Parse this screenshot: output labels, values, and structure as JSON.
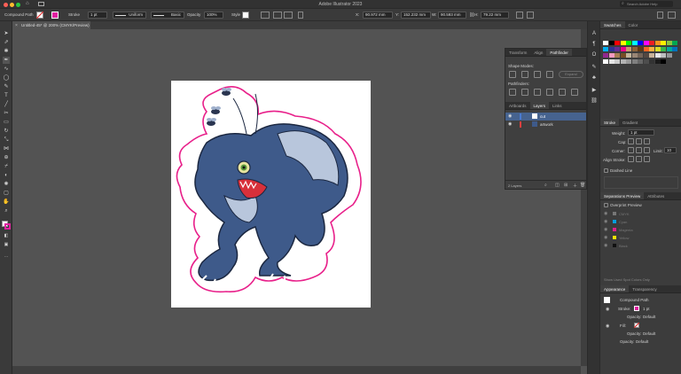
{
  "app_title": "Adobe Illustrator 2023",
  "search_placeholder": "Search Adobe Help",
  "control_bar": {
    "selection_label": "Compound Path",
    "stroke_label": "Stroke",
    "stroke_weight": "1 pt",
    "profile_uniform": "Uniform",
    "brush_basic": "Basic",
    "opacity_label": "Opacity",
    "opacity_value": "100%",
    "style_label": "Style",
    "x_value": "90.972 mm",
    "y_value": "152.232 mm",
    "w_value": "90.593 mm",
    "h_value": "79.22 mm"
  },
  "document_tab": {
    "title": "Untitled-45* @ 200% (CMYK/Preview)"
  },
  "pathfinder_panel": {
    "tabs": [
      "Transform",
      "Align",
      "Pathfinder"
    ],
    "active_tab": "Pathfinder",
    "shape_modes_label": "Shape Modes:",
    "expand_button": "Expand",
    "pathfinders_label": "Pathfinders:"
  },
  "layers_panel": {
    "tabs": [
      "Artboards",
      "Layers",
      "Links"
    ],
    "active_tab": "Layers",
    "layers": [
      {
        "name": "cut",
        "color": "#4a7bd0",
        "selected": true
      },
      {
        "name": "artwork",
        "color": "#e04040",
        "selected": false
      }
    ],
    "count": "2 Layers"
  },
  "swatches_panel": {
    "tabs": [
      "Swatches",
      "Color"
    ],
    "active_tab": "Swatches"
  },
  "stroke_panel": {
    "tabs": [
      "Stroke",
      "Gradient"
    ],
    "active_tab": "Stroke",
    "weight_label": "Weight:",
    "weight_value": "1 pt",
    "cap_label": "Cap:",
    "corner_label": "Corner:",
    "limit_label": "Limit:",
    "limit_value": "10",
    "align_label": "Align Stroke:",
    "dashed_label": "Dashed Line"
  },
  "separations_panel": {
    "tabs": [
      "Separations Preview",
      "Attributes"
    ],
    "active_tab": "Separations Preview",
    "overprint_label": "Overprint Preview",
    "inks": [
      {
        "name": "CMYK",
        "color": "#777777"
      },
      {
        "name": "Cyan",
        "color": "#00a0e0"
      },
      {
        "name": "Magenta",
        "color": "#e0208a"
      },
      {
        "name": "Yellow",
        "color": "#f5e400"
      },
      {
        "name": "Black",
        "color": "#111111"
      }
    ],
    "used_only_label": "Show Used Spot Colors Only"
  },
  "appearance_panel": {
    "tabs": [
      "Appearance",
      "Transparency"
    ],
    "active_tab": "Appearance",
    "object_label": "Compound Path",
    "stroke_label": "Stroke:",
    "stroke_value": "1 pt",
    "opacity_label": "Opacity:",
    "opacity_value": "Default",
    "fill_label": "Fill:"
  },
  "colors": {
    "accent_magenta": "#e020a0",
    "cut_line": "#e8208a",
    "monster_blue": "#3e5a8a"
  }
}
